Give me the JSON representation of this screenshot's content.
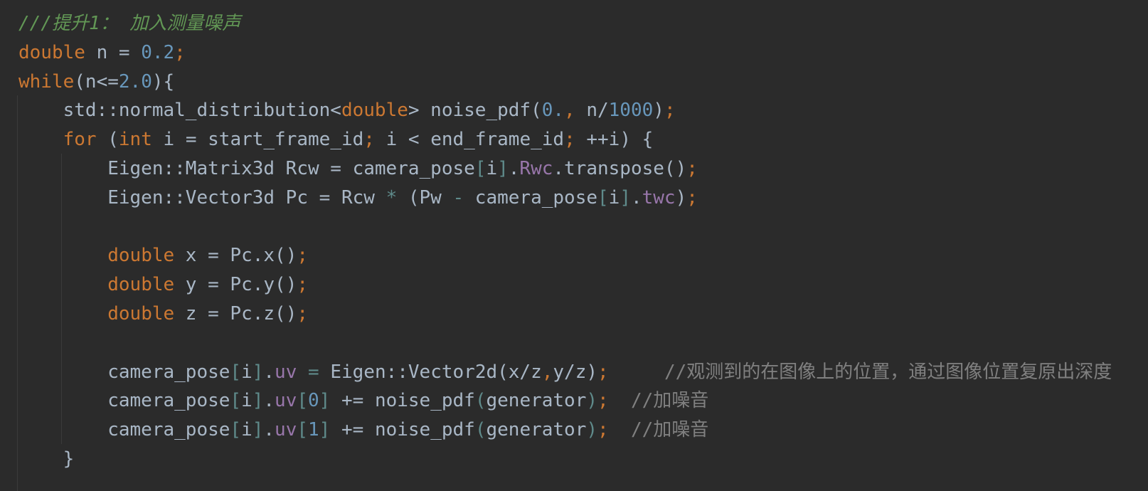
{
  "editor": {
    "language": "cpp",
    "theme": "darcula",
    "colors": {
      "background": "#2b2b2b",
      "text": "#a9b7c6",
      "keyword": "#cc7832",
      "number": "#6897bb",
      "comment": "#808080",
      "doc_comment": "#629755",
      "field": "#9876aa"
    },
    "lines": [
      {
        "tokens": [
          {
            "t": "///提升1： 加入测量噪声",
            "c": "doc"
          }
        ]
      },
      {
        "tokens": [
          {
            "t": "double",
            "c": "kw"
          },
          {
            "t": " n = ",
            "c": ""
          },
          {
            "t": "0.2",
            "c": "num"
          },
          {
            "t": ";",
            "c": "semi"
          }
        ]
      },
      {
        "tokens": [
          {
            "t": "while",
            "c": "kw"
          },
          {
            "t": "(n<=",
            "c": ""
          },
          {
            "t": "2.0",
            "c": "num"
          },
          {
            "t": "){",
            "c": ""
          }
        ]
      },
      {
        "tokens": [
          {
            "t": "    std::normal_distribution<",
            "c": ""
          },
          {
            "t": "double",
            "c": "kw"
          },
          {
            "t": "> noise_pdf(",
            "c": ""
          },
          {
            "t": "0.",
            "c": "num"
          },
          {
            "t": ",",
            "c": "semi"
          },
          {
            "t": " n/",
            "c": ""
          },
          {
            "t": "1000",
            "c": "num"
          },
          {
            "t": ")",
            "c": ""
          },
          {
            "t": ";",
            "c": "semi"
          }
        ]
      },
      {
        "tokens": [
          {
            "t": "    ",
            "c": ""
          },
          {
            "t": "for",
            "c": "kw"
          },
          {
            "t": " (",
            "c": ""
          },
          {
            "t": "int",
            "c": "kw"
          },
          {
            "t": " i = start_frame_id",
            "c": ""
          },
          {
            "t": ";",
            "c": "semi"
          },
          {
            "t": " i < end_frame_id",
            "c": ""
          },
          {
            "t": ";",
            "c": "semi"
          },
          {
            "t": " ++i) {",
            "c": ""
          }
        ]
      },
      {
        "tokens": [
          {
            "t": "        Eigen::Matrix3d Rcw = camera_pose",
            "c": ""
          },
          {
            "t": "[",
            "c": "br"
          },
          {
            "t": "i",
            "c": ""
          },
          {
            "t": "]",
            "c": "br"
          },
          {
            "t": ".",
            "c": ""
          },
          {
            "t": "Rwc",
            "c": "field"
          },
          {
            "t": ".transpose()",
            "c": ""
          },
          {
            "t": ";",
            "c": "semi"
          }
        ]
      },
      {
        "tokens": [
          {
            "t": "        Eigen::Vector3d Pc = Rcw ",
            "c": ""
          },
          {
            "t": "*",
            "c": "br"
          },
          {
            "t": " (Pw ",
            "c": ""
          },
          {
            "t": "-",
            "c": "br"
          },
          {
            "t": " camera_pose",
            "c": ""
          },
          {
            "t": "[",
            "c": "br"
          },
          {
            "t": "i",
            "c": ""
          },
          {
            "t": "]",
            "c": "br"
          },
          {
            "t": ".",
            "c": ""
          },
          {
            "t": "twc",
            "c": "field"
          },
          {
            "t": ")",
            "c": ""
          },
          {
            "t": ";",
            "c": "semi"
          }
        ]
      },
      {
        "tokens": []
      },
      {
        "tokens": [
          {
            "t": "        ",
            "c": ""
          },
          {
            "t": "double",
            "c": "kw"
          },
          {
            "t": " x = Pc.x()",
            "c": ""
          },
          {
            "t": ";",
            "c": "semi"
          }
        ]
      },
      {
        "tokens": [
          {
            "t": "        ",
            "c": ""
          },
          {
            "t": "double",
            "c": "kw"
          },
          {
            "t": " y = Pc.y()",
            "c": ""
          },
          {
            "t": ";",
            "c": "semi"
          }
        ]
      },
      {
        "tokens": [
          {
            "t": "        ",
            "c": ""
          },
          {
            "t": "double",
            "c": "kw"
          },
          {
            "t": " z = Pc.z()",
            "c": ""
          },
          {
            "t": ";",
            "c": "semi"
          }
        ]
      },
      {
        "tokens": []
      },
      {
        "tokens": [
          {
            "t": "        camera_pose",
            "c": ""
          },
          {
            "t": "[",
            "c": "br"
          },
          {
            "t": "i",
            "c": ""
          },
          {
            "t": "]",
            "c": "br"
          },
          {
            "t": ".",
            "c": ""
          },
          {
            "t": "uv",
            "c": "field"
          },
          {
            "t": " = ",
            "c": "br"
          },
          {
            "t": "Eigen::Vector2d(x/z",
            "c": ""
          },
          {
            "t": ",",
            "c": "semi"
          },
          {
            "t": "y/z)",
            "c": ""
          },
          {
            "t": ";",
            "c": "semi"
          },
          {
            "t": "     //观测到的在图像上的位置，通过图像位置复原出深度",
            "c": "cmt"
          }
        ]
      },
      {
        "tokens": [
          {
            "t": "        camera_pose",
            "c": ""
          },
          {
            "t": "[",
            "c": "br"
          },
          {
            "t": "i",
            "c": ""
          },
          {
            "t": "]",
            "c": "br"
          },
          {
            "t": ".",
            "c": ""
          },
          {
            "t": "uv",
            "c": "field"
          },
          {
            "t": "[",
            "c": "br"
          },
          {
            "t": "0",
            "c": "num"
          },
          {
            "t": "]",
            "c": "br"
          },
          {
            "t": " += noise_pdf",
            "c": ""
          },
          {
            "t": "(",
            "c": "br"
          },
          {
            "t": "generator",
            "c": ""
          },
          {
            "t": ")",
            "c": "br"
          },
          {
            "t": ";",
            "c": "semi"
          },
          {
            "t": "  //加噪音",
            "c": "cmt"
          }
        ]
      },
      {
        "tokens": [
          {
            "t": "        camera_pose",
            "c": ""
          },
          {
            "t": "[",
            "c": "br"
          },
          {
            "t": "i",
            "c": ""
          },
          {
            "t": "]",
            "c": "br"
          },
          {
            "t": ".",
            "c": ""
          },
          {
            "t": "uv",
            "c": "field"
          },
          {
            "t": "[",
            "c": "br"
          },
          {
            "t": "1",
            "c": "num"
          },
          {
            "t": "]",
            "c": "br"
          },
          {
            "t": " += noise_pdf",
            "c": ""
          },
          {
            "t": "(",
            "c": "br"
          },
          {
            "t": "generator",
            "c": ""
          },
          {
            "t": ")",
            "c": "br"
          },
          {
            "t": ";",
            "c": "semi"
          },
          {
            "t": "  //加噪音",
            "c": "cmt"
          }
        ]
      },
      {
        "tokens": [
          {
            "t": "    }",
            "c": ""
          }
        ]
      }
    ]
  }
}
